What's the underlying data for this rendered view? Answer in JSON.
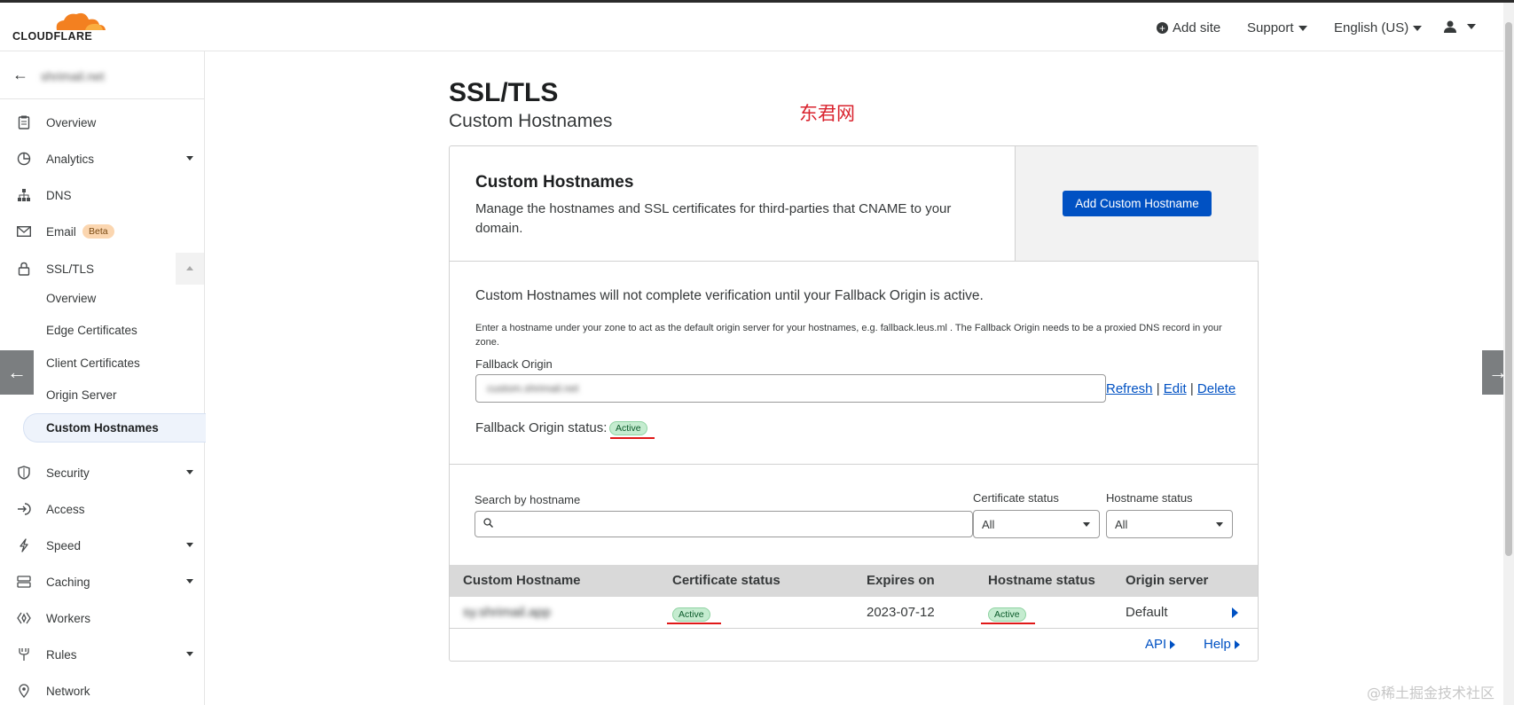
{
  "header": {
    "brand": "CLOUDFLARE",
    "add_site": "Add site",
    "support": "Support",
    "language": "English (US)"
  },
  "sidebar": {
    "domain": "shrimail.net",
    "items": [
      {
        "label": "Overview",
        "icon": "clipboard-icon"
      },
      {
        "label": "Analytics",
        "icon": "pie-chart-icon"
      },
      {
        "label": "DNS",
        "icon": "network-icon"
      },
      {
        "label": "Email",
        "icon": "envelope-icon",
        "badge": "Beta"
      },
      {
        "label": "SSL/TLS",
        "icon": "lock-icon"
      },
      {
        "label": "Security",
        "icon": "shield-icon"
      },
      {
        "label": "Access",
        "icon": "access-icon"
      },
      {
        "label": "Speed",
        "icon": "lightning-icon"
      },
      {
        "label": "Caching",
        "icon": "server-stack-icon"
      },
      {
        "label": "Workers",
        "icon": "workers-icon"
      },
      {
        "label": "Rules",
        "icon": "fork-icon"
      },
      {
        "label": "Network",
        "icon": "pin-icon"
      }
    ],
    "ssl_sub": [
      "Overview",
      "Edge Certificates",
      "Client Certificates",
      "Origin Server",
      "Custom Hostnames"
    ]
  },
  "page": {
    "title": "SSL/TLS",
    "subtitle": "Custom Hostnames",
    "watermark": "东君网",
    "footer_watermark": "@稀土掘金技术社区"
  },
  "intro": {
    "heading": "Custom Hostnames",
    "description": "Manage the hostnames and SSL certificates for third-parties that CNAME to your domain.",
    "button": "Add Custom Hostname"
  },
  "fallback": {
    "warning": "Custom Hostnames will not complete verification until your Fallback Origin is active.",
    "description": "Enter a hostname under your zone to act as the default origin server for your hostnames, e.g. fallback.leus.ml . The Fallback Origin needs to be a proxied DNS record in your zone.",
    "label": "Fallback Origin",
    "value": "custom.shrimail.net",
    "refresh": "Refresh",
    "edit": "Edit",
    "delete": "Delete",
    "sep": "|",
    "status_label": "Fallback Origin status:",
    "status": "Active"
  },
  "filters": {
    "search_label": "Search by hostname",
    "search_placeholder": "",
    "cert_label": "Certificate status",
    "cert_value": "All",
    "host_label": "Hostname status",
    "host_value": "All"
  },
  "table": {
    "columns": [
      "Custom Hostname",
      "Certificate status",
      "Expires on",
      "Hostname status",
      "Origin server"
    ],
    "rows": [
      {
        "hostname": "sy.shrimail.app",
        "cert_status": "Active",
        "expires": "2023-07-12",
        "host_status": "Active",
        "origin": "Default"
      }
    ]
  },
  "footer": {
    "api": "API",
    "help": "Help"
  },
  "colors": {
    "primary": "#0051c3",
    "active_badge": "#c5ecd0",
    "brand_orange": "#f38020",
    "annotation_red": "#e01818"
  }
}
